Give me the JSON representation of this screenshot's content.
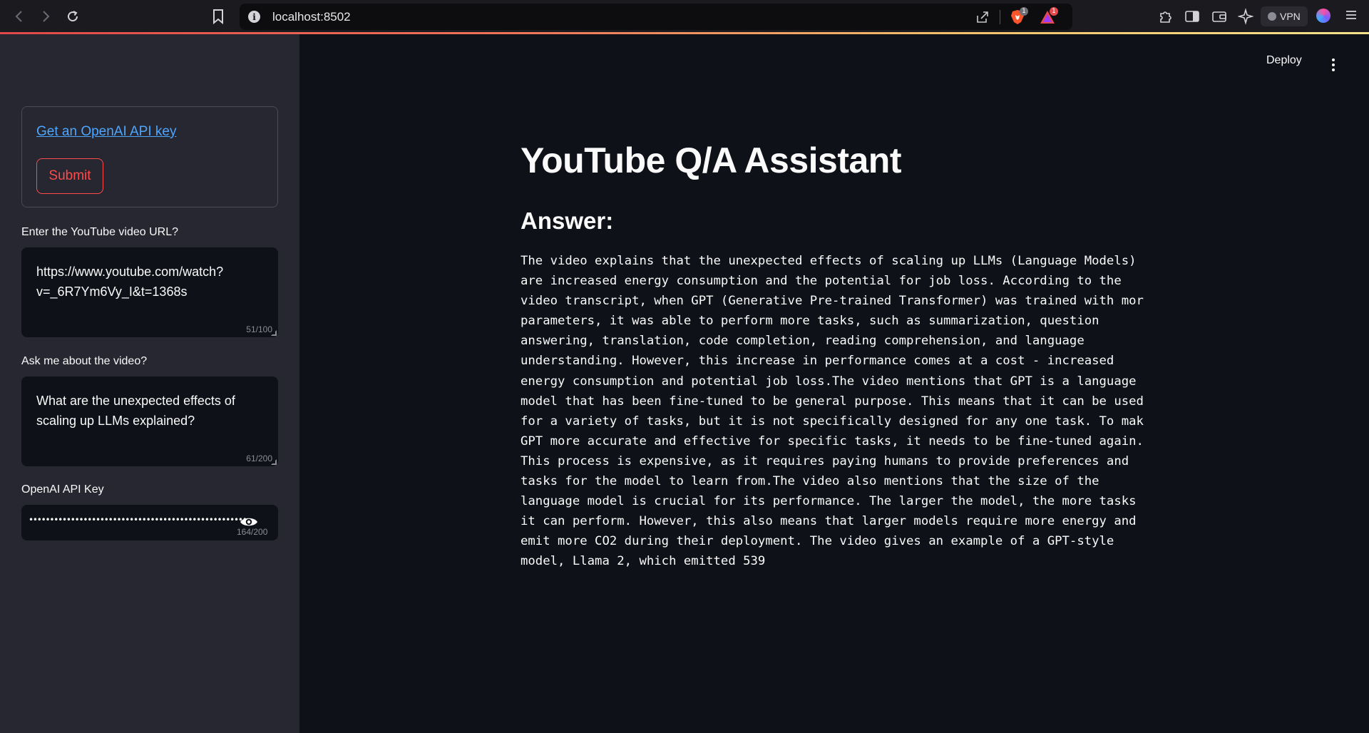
{
  "browser": {
    "url": "localhost:8502",
    "info_icon": "i",
    "shields_badge": "1",
    "rewards_badge": "1",
    "vpn_label": "VPN",
    "back_icon": "chevron-left-icon",
    "forward_icon": "chevron-right-icon",
    "reload_icon": "reload-icon"
  },
  "sidebar": {
    "api_link_text": "Get an OpenAI API key",
    "submit_label": "Submit",
    "url_field": {
      "label": "Enter the YouTube video URL?",
      "value_line1": "https://www.youtube.com/watch?",
      "value_line2": "v=_6R7Ym6Vy_I&t=1368s",
      "counter": "51/100"
    },
    "question_field": {
      "label": "Ask me about the video?",
      "value_line1": "What are the unexpected effects of",
      "value_line2": "scaling up LLMs explained?",
      "counter": "61/200"
    },
    "api_key_field": {
      "label": "OpenAI API Key",
      "masked_value": "••••••••••••••••••••••••••••••••••••••••••••••••••••••••",
      "counter": "164/200"
    }
  },
  "main": {
    "deploy_label": "Deploy",
    "title": "YouTube Q/A Assistant",
    "answer_heading": "Answer:",
    "answer_text": "The video explains that the unexpected effects of scaling up LLMs (Language Models)\nare increased energy consumption and the potential for job loss. According to the\nvideo transcript, when GPT (Generative Pre-trained Transformer) was trained with mor\nparameters, it was able to perform more tasks, such as summarization, question\nanswering, translation, code completion, reading comprehension, and language\nunderstanding. However, this increase in performance comes at a cost - increased\nenergy consumption and potential job loss.The video mentions that GPT is a language\nmodel that has been fine-tuned to be general purpose. This means that it can be used\nfor a variety of tasks, but it is not specifically designed for any one task. To mak\nGPT more accurate and effective for specific tasks, it needs to be fine-tuned again.\nThis process is expensive, as it requires paying humans to provide preferences and\ntasks for the model to learn from.The video also mentions that the size of the\nlanguage model is crucial for its performance. The larger the model, the more tasks\nit can perform. However, this also means that larger models require more energy and\nemit more CO2 during their deployment. The video gives an example of a GPT-style\nmodel, Llama 2, which emitted 539"
  },
  "colors": {
    "accent_red": "#ff4b4b",
    "link_blue": "#4da6ff",
    "sidebar_bg": "#262730",
    "main_bg": "#0e1117"
  }
}
